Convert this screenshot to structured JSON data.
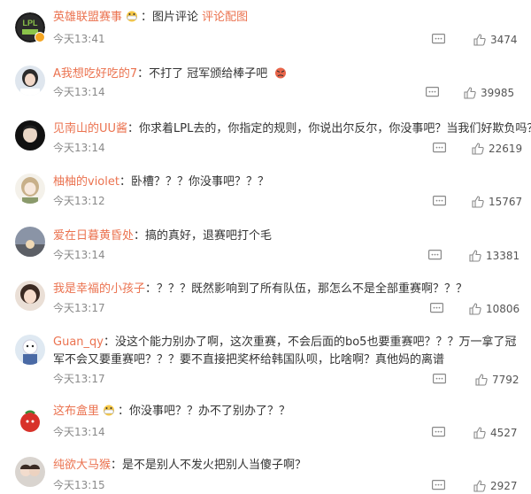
{
  "comments": [
    {
      "user": "英雄联盟赛事",
      "badge": "mask-emoji-badge",
      "text": "：图片评论 ",
      "link": "评论配图",
      "time": "今天13:41",
      "likes": "3474"
    },
    {
      "user": "A我想吃好吃的7",
      "text": "：不打了 冠军颁给棒子吧 ",
      "emoji": "angry-emoji",
      "time": "今天13:14",
      "likes": "39985"
    },
    {
      "user": "见南山的UU酱",
      "text": "：你求着LPL去的，你指定的规则，你说出尔反尔，你没事吧？当我们好欺负吗？",
      "time": "今天13:14",
      "likes": "22619"
    },
    {
      "user": "柚柚的violet",
      "text": "：卧槽？？？你没事吧？？？",
      "time": "今天13:12",
      "likes": "15767"
    },
    {
      "user": "爱在日暮黄昏处",
      "text": "：搞的真好，退赛吧打个毛",
      "time": "今天13:14",
      "likes": "13381"
    },
    {
      "user": "我是幸福的小孩子",
      "text": "：？？？既然影响到了所有队伍，那怎么不是全部重赛啊？？？",
      "time": "今天13:17",
      "likes": "10806"
    },
    {
      "user": "Guan_qy",
      "text": "：没这个能力别办了啊，这次重赛，不会后面的bo5也要重赛吧？？？万一拿了冠军不会又要重赛吧？？？要不直接把奖杯给韩国队呗，比啥啊？真他妈的离谱",
      "time": "今天13:17",
      "likes": "7792"
    },
    {
      "user": "这布盒里",
      "badge": "mask-emoji-badge",
      "text": "：你没事吧？？办不了别办了？？",
      "time": "今天13:14",
      "likes": "4527"
    },
    {
      "user": "纯欲大马猴",
      "text": "：是不是别人不发火把别人当傻子啊？",
      "time": "今天13:15",
      "likes": "2927"
    }
  ],
  "avatar_logo_text": "LPL"
}
